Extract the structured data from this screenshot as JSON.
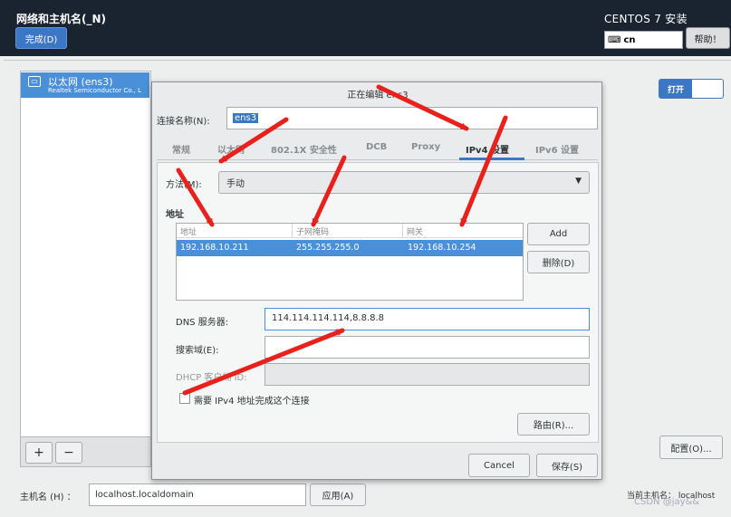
{
  "header": {
    "title": "网络和主机名(_N)",
    "done_label": "完成(D)",
    "installer_title": "CENTOS 7 安装",
    "keyboard_layout": "cn",
    "help_label": "帮助！"
  },
  "interfaces": [
    {
      "name": "以太网 (ens3)",
      "vendor": "Realtek Semiconductor Co., L"
    }
  ],
  "toolbar": {
    "add_label": "+",
    "remove_label": "−"
  },
  "toggle_label": "打开",
  "config_label": "配置(O)...",
  "hostname": {
    "label": "主机名 (H) ：",
    "value": "localhost.localdomain",
    "apply_label": "应用(A)",
    "current_label": "当前主机名：   localhost"
  },
  "watermark": "CSDN @jay&&",
  "dialog": {
    "title": "正在编辑 ens3",
    "connection_name_label": "连接名称(N):",
    "connection_name": "ens3",
    "tabs": [
      "常规",
      "以太网",
      "802.1X 安全性",
      "DCB",
      "Proxy",
      "IPv4 设置",
      "IPv6 设置"
    ],
    "active_tab": "IPv4 设置",
    "method_label": "方法(M):",
    "method_value": "手动",
    "address_section": "地址",
    "columns": [
      "地址",
      "子网掩码",
      "网关"
    ],
    "rows": [
      [
        "192.168.10.211",
        "255.255.255.0",
        "192.168.10.254"
      ]
    ],
    "add_label": "Add",
    "delete_label": "删除(D)",
    "dns_label": "DNS 服务器:",
    "dns_value": "114.114.114.114,8.8.8.8",
    "search_label": "搜索域(E):",
    "search_value": "",
    "dhcp_label": "DHCP 客户端 ID:",
    "dhcp_value": "",
    "require_ipv4_label": "需要 IPv4 地址完成这个连接",
    "routes_label": "路由(R)...",
    "cancel_label": "Cancel",
    "save_label": "保存(S)"
  },
  "colors": {
    "accent": "#3b77c4",
    "selection": "#4a90d9",
    "annotation_arrow": "#e8211c"
  }
}
